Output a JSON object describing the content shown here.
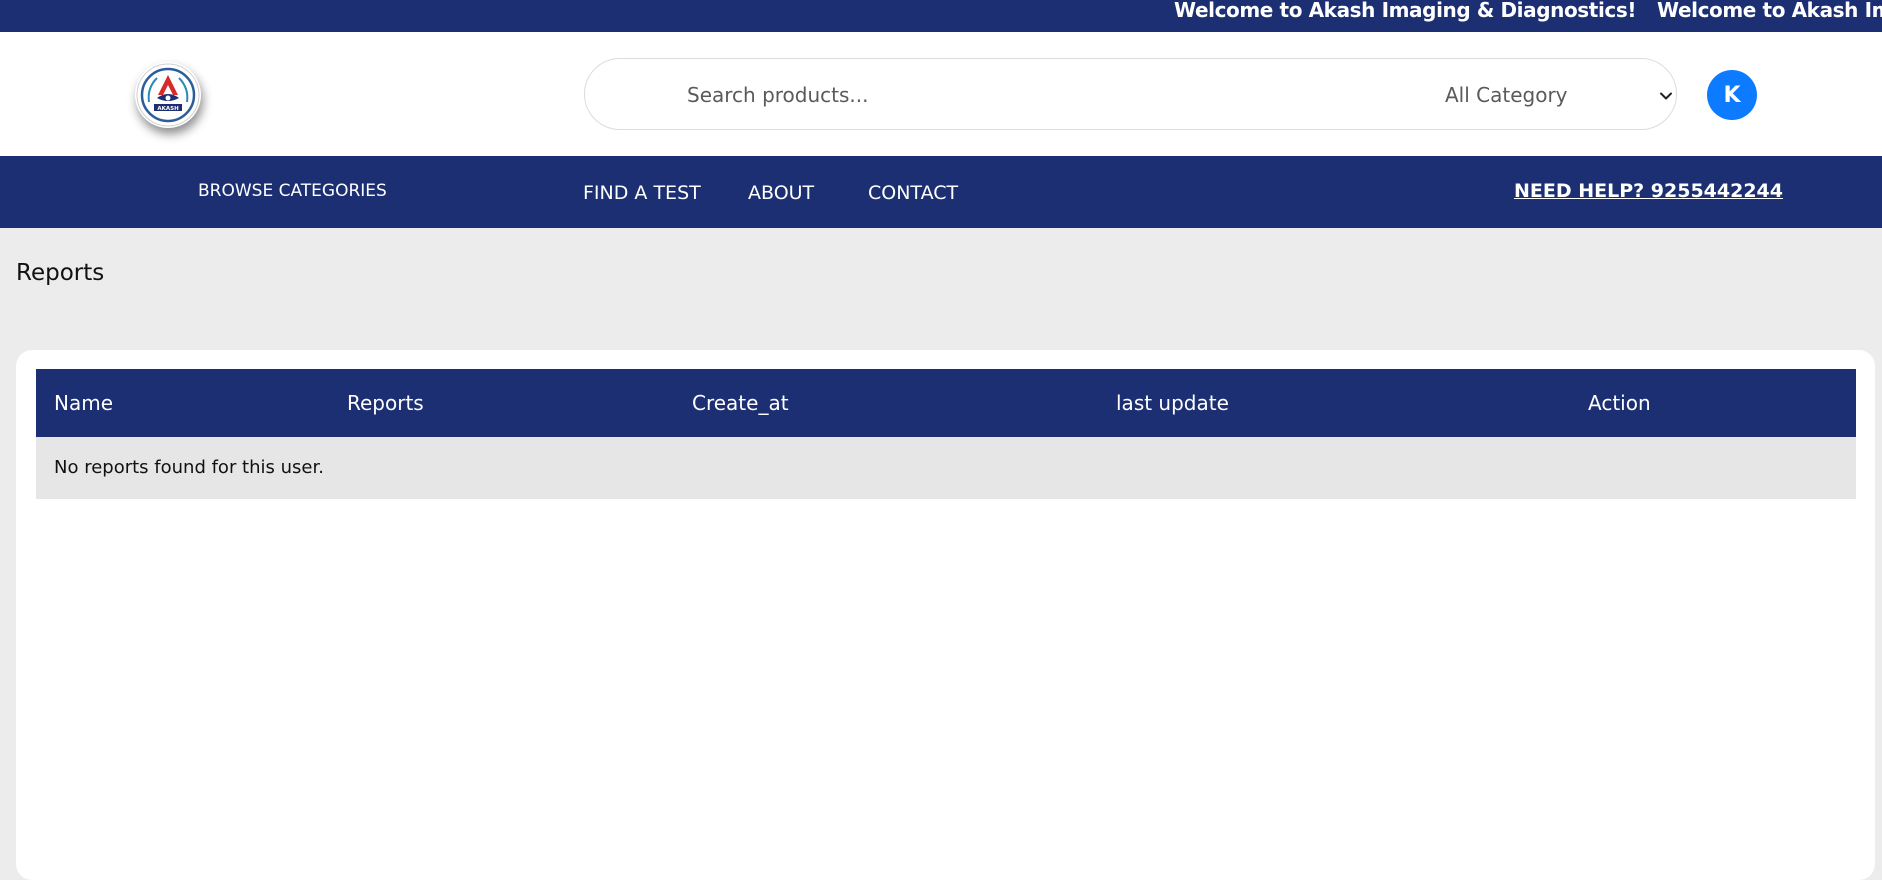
{
  "announcement": {
    "text": "Welcome to Akash Imaging & Diagnostics!",
    "text_repeat": "Welcome to Akash Im"
  },
  "header": {
    "logo_text": "AKASH",
    "search": {
      "placeholder": "Search products...",
      "value": ""
    },
    "category_select": {
      "selected": "All Category"
    },
    "avatar_initial": "K"
  },
  "nav": {
    "browse_label": "BROWSE CATEGORIES",
    "items": [
      {
        "label": "FIND A TEST"
      },
      {
        "label": "ABOUT"
      },
      {
        "label": "CONTACT"
      }
    ],
    "help_text": "NEED HELP? 9255442244"
  },
  "page": {
    "title": "Reports"
  },
  "reports_table": {
    "columns": [
      "Name",
      "Reports",
      "Create_at",
      "last update",
      "Action"
    ],
    "rows": [],
    "empty_message": "No reports found for this user."
  },
  "colors": {
    "brand_navy": "#1b2f72",
    "avatar_blue": "#0d7bff",
    "page_bg": "#ececec",
    "empty_row_bg": "#e6e6e6"
  },
  "icons": {
    "dropdown": "chevron-down-icon",
    "logo": "akash-logo-icon"
  }
}
